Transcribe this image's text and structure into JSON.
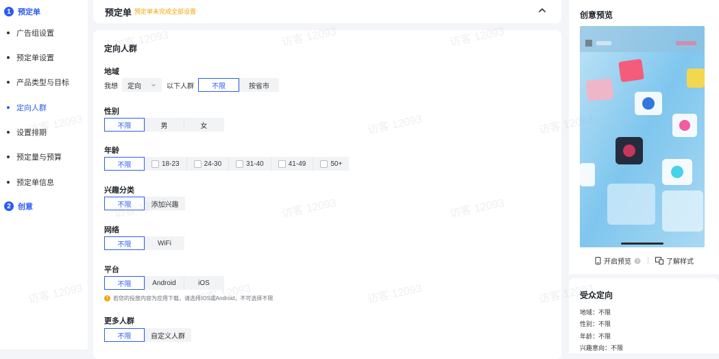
{
  "sidebar": {
    "steps": [
      {
        "num": "1",
        "label": "预定单"
      },
      {
        "num": "2",
        "label": "创意"
      }
    ],
    "items": [
      {
        "label": "广告组设置"
      },
      {
        "label": "预定单设置"
      },
      {
        "label": "产品类型与目标"
      },
      {
        "label": "定向人群"
      },
      {
        "label": "设置排期"
      },
      {
        "label": "预定量与预算"
      },
      {
        "label": "预定单信息"
      }
    ]
  },
  "header": {
    "title": "预定单",
    "warning": "预定单未完成全部设置"
  },
  "main": {
    "section_title": "定向人群",
    "region": {
      "label": "地域",
      "prefix": "我想",
      "select_value": "定向",
      "middle": "以下人群",
      "options": [
        "不限",
        "按省市"
      ]
    },
    "gender": {
      "label": "性别",
      "options": [
        "不限",
        "男",
        "女"
      ]
    },
    "age": {
      "label": "年龄",
      "selected": "不限",
      "checks": [
        "18-23",
        "24-30",
        "31-40",
        "41-49",
        "50+"
      ]
    },
    "interest": {
      "label": "兴趣分类",
      "options": [
        "不限",
        "添加兴趣"
      ]
    },
    "network": {
      "label": "网络",
      "options": [
        "不限",
        "WiFi"
      ]
    },
    "platform": {
      "label": "平台",
      "options": [
        "不限",
        "Android",
        "iOS"
      ]
    },
    "platform_tip": "若您的投放内容为应用下载，请选择IOS或Android，不可选择不限",
    "more": {
      "label": "更多人群",
      "options": [
        "不限",
        "自定义人群"
      ]
    }
  },
  "preview": {
    "title": "创意预览",
    "open_preview": "开启预览",
    "learn_style": "了解样式"
  },
  "audience": {
    "title": "受众定向",
    "lines": [
      "地域：不限",
      "性别：不限",
      "年龄：不限",
      "兴趣意向：不限"
    ]
  },
  "watermark": "访客 12093",
  "colors": {
    "accent": "#2a5bf6",
    "warning": "#f5a400"
  }
}
